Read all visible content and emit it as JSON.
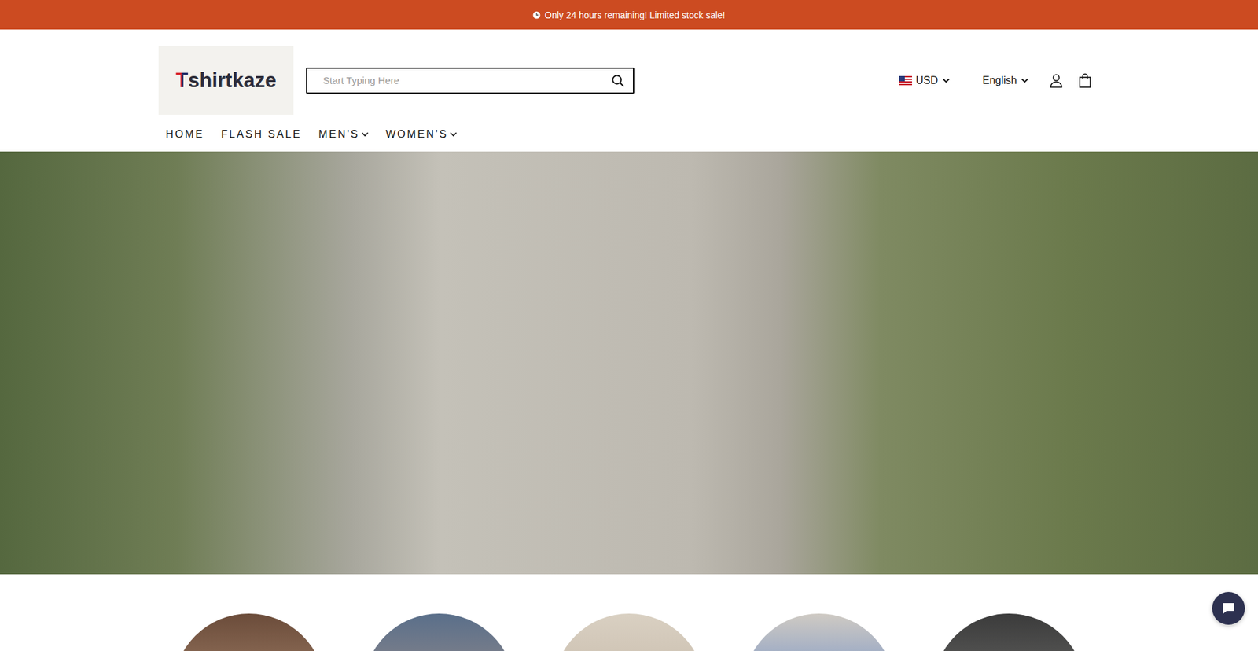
{
  "announcement": {
    "text": "Only 24 hours remaining! Limited stock sale!"
  },
  "logo": {
    "initial": "T",
    "rest": "shirtkaze"
  },
  "search": {
    "placeholder": "Start Typing Here"
  },
  "currency": {
    "label": "USD"
  },
  "language": {
    "label": "English"
  },
  "nav": [
    {
      "label": "HOME",
      "has_menu": false
    },
    {
      "label": "FLASH SALE",
      "has_menu": false
    },
    {
      "label": "MEN'S",
      "has_menu": true
    },
    {
      "label": "WOMEN'S",
      "has_menu": true
    }
  ]
}
